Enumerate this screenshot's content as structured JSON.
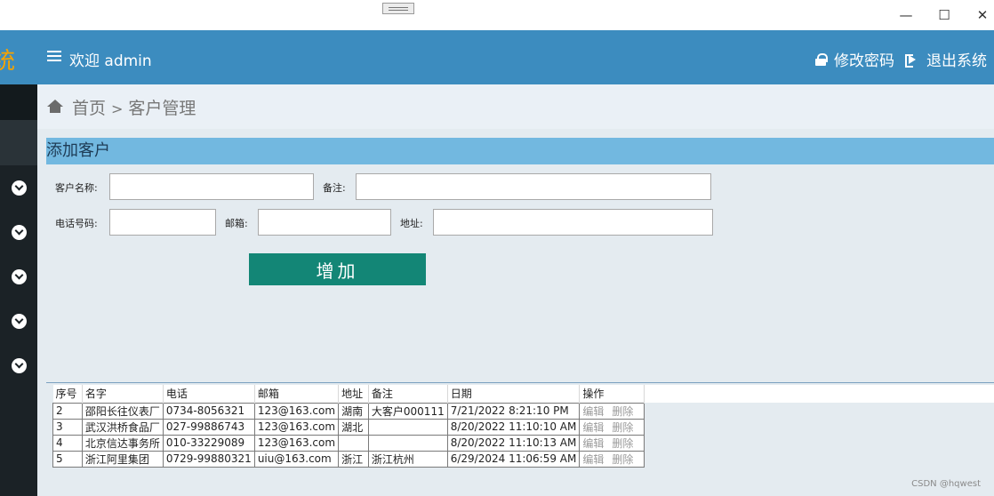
{
  "window": {
    "minimize": "—",
    "maximize": "☐",
    "close": "✕"
  },
  "sidebar": {
    "brand_fragment": "统",
    "items": [
      {
        "icon": "chevron-down-circle-icon"
      },
      {
        "icon": "chevron-down-circle-icon"
      },
      {
        "icon": "chevron-down-circle-icon"
      },
      {
        "icon": "chevron-down-circle-icon"
      },
      {
        "icon": "chevron-down-circle-icon"
      }
    ]
  },
  "header": {
    "welcome": "欢迎 admin",
    "change_password": "修改密码",
    "logout": "退出系统"
  },
  "breadcrumb": {
    "home": "首页",
    "separator": ">",
    "current": "客户管理"
  },
  "form": {
    "title": "添加客户",
    "name_label": "客户名称:",
    "name_value": "",
    "remark_label": "备注:",
    "remark_value": "",
    "phone_label": "电话号码:",
    "phone_value": "",
    "email_label": "邮箱:",
    "email_value": "",
    "address_label": "地址:",
    "address_value": "",
    "add_button": "增加"
  },
  "table": {
    "columns": [
      "序号",
      "名字",
      "电话",
      "邮箱",
      "地址",
      "备注",
      "日期",
      "操作"
    ],
    "rows": [
      {
        "id": "2",
        "name": "邵阳长往仪表厂",
        "phone": "0734-8056321",
        "email": "123@163.com",
        "address": "湖南",
        "remark": "大客户000111",
        "date": "7/21/2022 8:21:10 PM"
      },
      {
        "id": "3",
        "name": "武汉洪桥食品厂",
        "phone": "027-99886743",
        "email": "123@163.com",
        "address": "湖北",
        "remark": "",
        "date": "8/20/2022 11:10:10 AM"
      },
      {
        "id": "4",
        "name": "北京信达事务所",
        "phone": "010-33229089",
        "email": "123@163.com",
        "address": "",
        "remark": "",
        "date": "8/20/2022 11:10:13 AM"
      },
      {
        "id": "5",
        "name": "浙江阿里集团",
        "phone": "0729-99880321",
        "email": "uiu@163.com",
        "address": "浙江",
        "remark": "浙江杭州",
        "date": "6/29/2024 11:06:59 AM"
      }
    ],
    "edit_label": "编辑",
    "delete_label": "删除"
  },
  "watermark": "CSDN @hqwest",
  "colors": {
    "header": "#3c8cbf",
    "panel_title": "#72b8e0",
    "add_button": "#138676",
    "sidebar": "#1b2226",
    "brand": "#f6a300"
  }
}
